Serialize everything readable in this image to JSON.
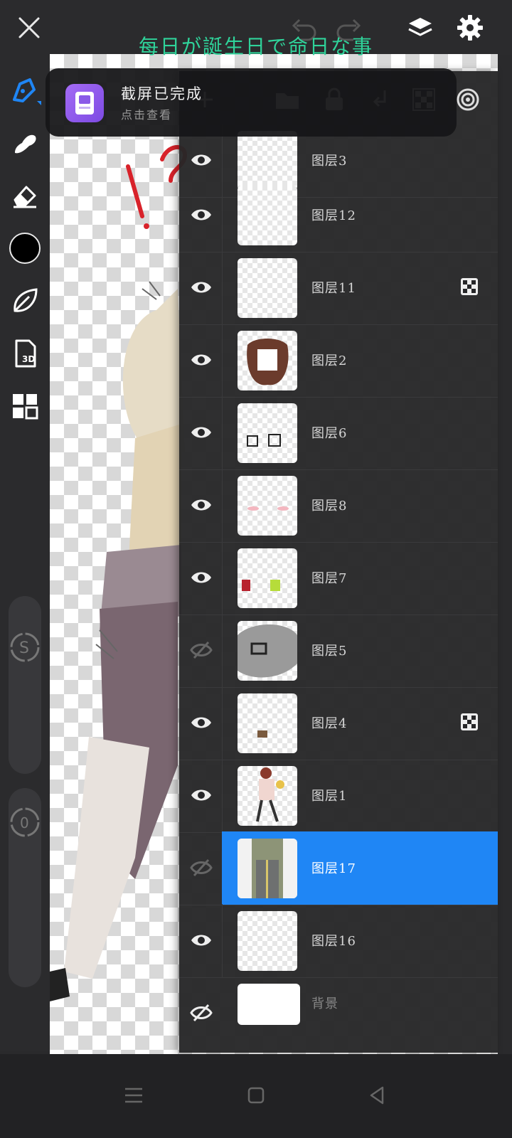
{
  "canvas": {
    "title": "每日が誕生日で命日な事"
  },
  "notification": {
    "title": "截屏已完成",
    "subtitle": "点击查看",
    "icon": "screenshot-app-icon"
  },
  "layers": [
    {
      "name": "图层3",
      "visible": true,
      "badge": false,
      "selected": false
    },
    {
      "name": "图层12",
      "visible": true,
      "badge": false,
      "selected": false
    },
    {
      "name": "图层11",
      "visible": true,
      "badge": true,
      "selected": false
    },
    {
      "name": "图层2",
      "visible": true,
      "badge": false,
      "selected": false
    },
    {
      "name": "图层6",
      "visible": true,
      "badge": false,
      "selected": false
    },
    {
      "name": "图层8",
      "visible": true,
      "badge": false,
      "selected": false
    },
    {
      "name": "图层7",
      "visible": true,
      "badge": false,
      "selected": false
    },
    {
      "name": "图层5",
      "visible": false,
      "badge": false,
      "selected": false
    },
    {
      "name": "图层4",
      "visible": true,
      "badge": true,
      "selected": false
    },
    {
      "name": "图层1",
      "visible": true,
      "badge": false,
      "selected": false
    },
    {
      "name": "图层17",
      "visible": false,
      "badge": false,
      "selected": true
    },
    {
      "name": "图层16",
      "visible": true,
      "badge": false,
      "selected": false
    },
    {
      "name": "背景",
      "visible": false,
      "badge": false,
      "selected": false
    }
  ],
  "colors": {
    "accent": "#1f86f5",
    "current_color": "#000000",
    "title_color": "#2fd39a"
  }
}
